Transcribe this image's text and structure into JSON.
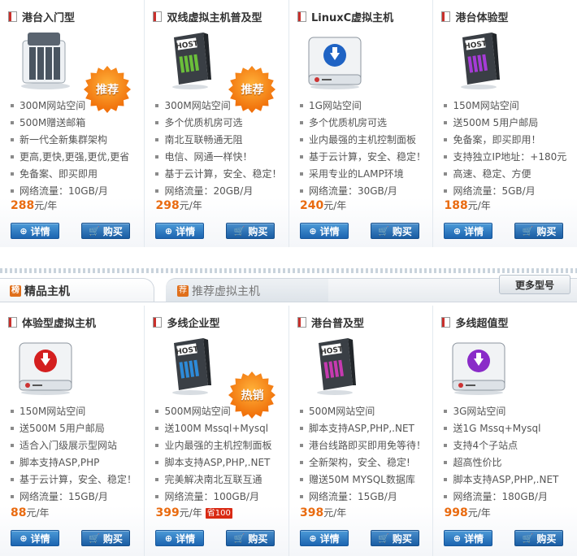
{
  "tabs": {
    "active_label": "精品主机",
    "active_icon": "榜",
    "inactive_label": "推荐虚拟主机",
    "inactive_icon": "荐",
    "more_label": "更多型号"
  },
  "buttons": {
    "detail": "详情",
    "buy": "购买"
  },
  "price_unit": "元/年",
  "top": [
    {
      "title": "港台入门型",
      "image": "server-icon",
      "badge": "推荐",
      "features": [
        "300M网站空间",
        "500M赠送邮箱",
        "新一代全新集群架构",
        "更高,更快,更强,更优,更省",
        "免备案、即买即用",
        "网络流量：10GB/月"
      ],
      "price": "288"
    },
    {
      "title": "双线虚拟主机普及型",
      "image": "host-drive-icon",
      "badge": "推荐",
      "features": [
        "300M网站空间",
        "多个优质机房可选",
        "南北互联畅通无阻",
        "电信、网通一样快！",
        "基于云计算，安全、稳定！",
        "网络流量：20GB/月"
      ],
      "price": "298"
    },
    {
      "title": "LinuxC虚拟主机",
      "image": "hdd-blue-icon",
      "badge": "",
      "features": [
        "1G网站空间",
        "多个优质机房可选",
        "业内最强的主机控制面板",
        "基于云计算，安全、稳定！",
        "采用专业的LAMP环境",
        "网络流量：30GB/月"
      ],
      "price": "240"
    },
    {
      "title": "港台体验型",
      "image": "host-drive-purple-icon",
      "badge": "",
      "features": [
        "150M网站空间",
        "送500M 5用户邮局",
        "免备案，即买即用！",
        "支持独立IP地址：+180元",
        "高速、稳定、方便",
        "网络流量：5GB/月"
      ],
      "price": "188"
    }
  ],
  "bottom": [
    {
      "title": "体验型虚拟主机",
      "image": "hdd-red-icon",
      "badge": "",
      "features": [
        "150M网站空间",
        "送500M 5用户邮局",
        "适合入门级展示型网站",
        "脚本支持ASP,PHP",
        "基于云计算，安全、稳定！",
        "网络流量：15GB/月"
      ],
      "price": "88",
      "save": ""
    },
    {
      "title": "多线企业型",
      "image": "host-drive-blue-icon",
      "badge": "热销",
      "features": [
        "500M网站空间",
        "送100M Mssql+Mysql",
        "业内最强的主机控制面板",
        "脚本支持ASP,PHP,.NET",
        "完美解决南北互联互通",
        "网络流量：100GB/月"
      ],
      "price": "399",
      "save": "省100"
    },
    {
      "title": "港台普及型",
      "image": "host-drive-pink-icon",
      "badge": "",
      "features": [
        "500M网站空间",
        "脚本支持ASP,PHP,.NET",
        "港台线路即买即用免等待！",
        "全新架构，安全、稳定!",
        "赠送50M MYSQL数据库",
        "网络流量：15GB/月"
      ],
      "price": "398",
      "save": ""
    },
    {
      "title": "多线超值型",
      "image": "hdd-purple-icon",
      "badge": "",
      "features": [
        "3G网站空间",
        "送1G Mssq+Mysql",
        "支持4个子站点",
        "超高性价比",
        "脚本支持ASP,PHP,.NET",
        "网络流量：180GB/月"
      ],
      "price": "998",
      "save": ""
    }
  ]
}
